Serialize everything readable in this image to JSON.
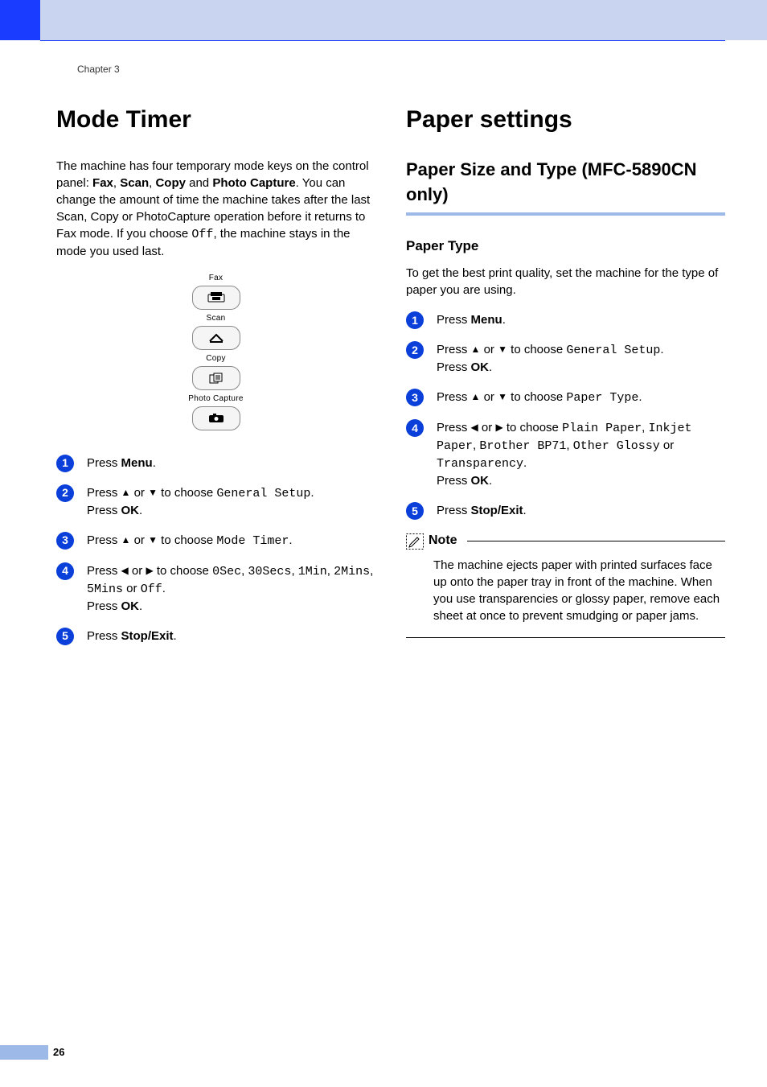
{
  "chapter": "Chapter 3",
  "page_number": "26",
  "left": {
    "title": "Mode Timer",
    "intro_parts": [
      "The machine has four temporary mode keys on the control panel: ",
      "Fax",
      ", ",
      "Scan",
      ", ",
      "Copy",
      " and ",
      "Photo Capture",
      ". You can change the amount of time the machine takes after the last Scan, Copy or PhotoCapture operation before it returns to Fax mode. If you choose ",
      "Off",
      ", the machine stays in the mode you used last."
    ],
    "panel": {
      "fax": "Fax",
      "scan": "Scan",
      "copy": "Copy",
      "photo": "Photo Capture"
    },
    "steps": {
      "s1": {
        "a": "Press ",
        "b": "Menu",
        "c": "."
      },
      "s2": {
        "a": "Press ",
        "up": "▲",
        "mid": " or ",
        "down": "▼",
        "b": " to choose ",
        "code": "General Setup",
        "c": ".",
        "d": "Press ",
        "e": "OK",
        "f": "."
      },
      "s3": {
        "a": "Press ",
        "up": "▲",
        "mid": " or ",
        "down": "▼",
        "b": " to choose ",
        "code": "Mode Timer",
        "c": "."
      },
      "s4": {
        "a": "Press ",
        "left": "◀",
        "mid": " or ",
        "right": "▶",
        "b": " to choose ",
        "v1": "0Sec",
        "c1": ", ",
        "v2": "30Secs",
        "c2": ", ",
        "v3": "1Min",
        "c3": ", ",
        "v4": "2Mins",
        "c4": ", ",
        "v5": "5Mins",
        "c5": " or ",
        "v6": "Off",
        "c6": ".",
        "d": "Press ",
        "e": "OK",
        "f": "."
      },
      "s5": {
        "a": "Press ",
        "b": "Stop/Exit",
        "c": "."
      }
    }
  },
  "right": {
    "title": "Paper settings",
    "subtitle": "Paper Size and Type (MFC-5890CN only)",
    "subhead": "Paper Type",
    "intro": "To get the best print quality, set the machine for the type of paper you are using.",
    "steps": {
      "s1": {
        "a": "Press ",
        "b": "Menu",
        "c": "."
      },
      "s2": {
        "a": "Press ",
        "up": "▲",
        "mid": " or ",
        "down": "▼",
        "b": " to choose ",
        "code": "General Setup",
        "c": ".",
        "d": "Press ",
        "e": "OK",
        "f": "."
      },
      "s3": {
        "a": "Press ",
        "up": "▲",
        "mid": " or ",
        "down": "▼",
        "b": " to choose ",
        "code": "Paper Type",
        "c": "."
      },
      "s4": {
        "a": "Press ",
        "left": "◀",
        "mid": " or ",
        "right": "▶",
        "b": " to choose ",
        "v1": "Plain Paper",
        "c1": ", ",
        "v2": "Inkjet Paper",
        "c2": ", ",
        "v3": "Brother BP71",
        "c3": ", ",
        "v4": "Other Glossy",
        "c4": " or ",
        "v5": "Transparency",
        "c5": ".",
        "d": "Press ",
        "e": "OK",
        "f": "."
      },
      "s5": {
        "a": "Press ",
        "b": "Stop/Exit",
        "c": "."
      }
    },
    "note": {
      "title": "Note",
      "body": "The machine ejects paper with printed surfaces face up onto the paper tray in front of the machine. When you use transparencies or glossy paper, remove each sheet at once to prevent smudging or paper jams."
    }
  }
}
